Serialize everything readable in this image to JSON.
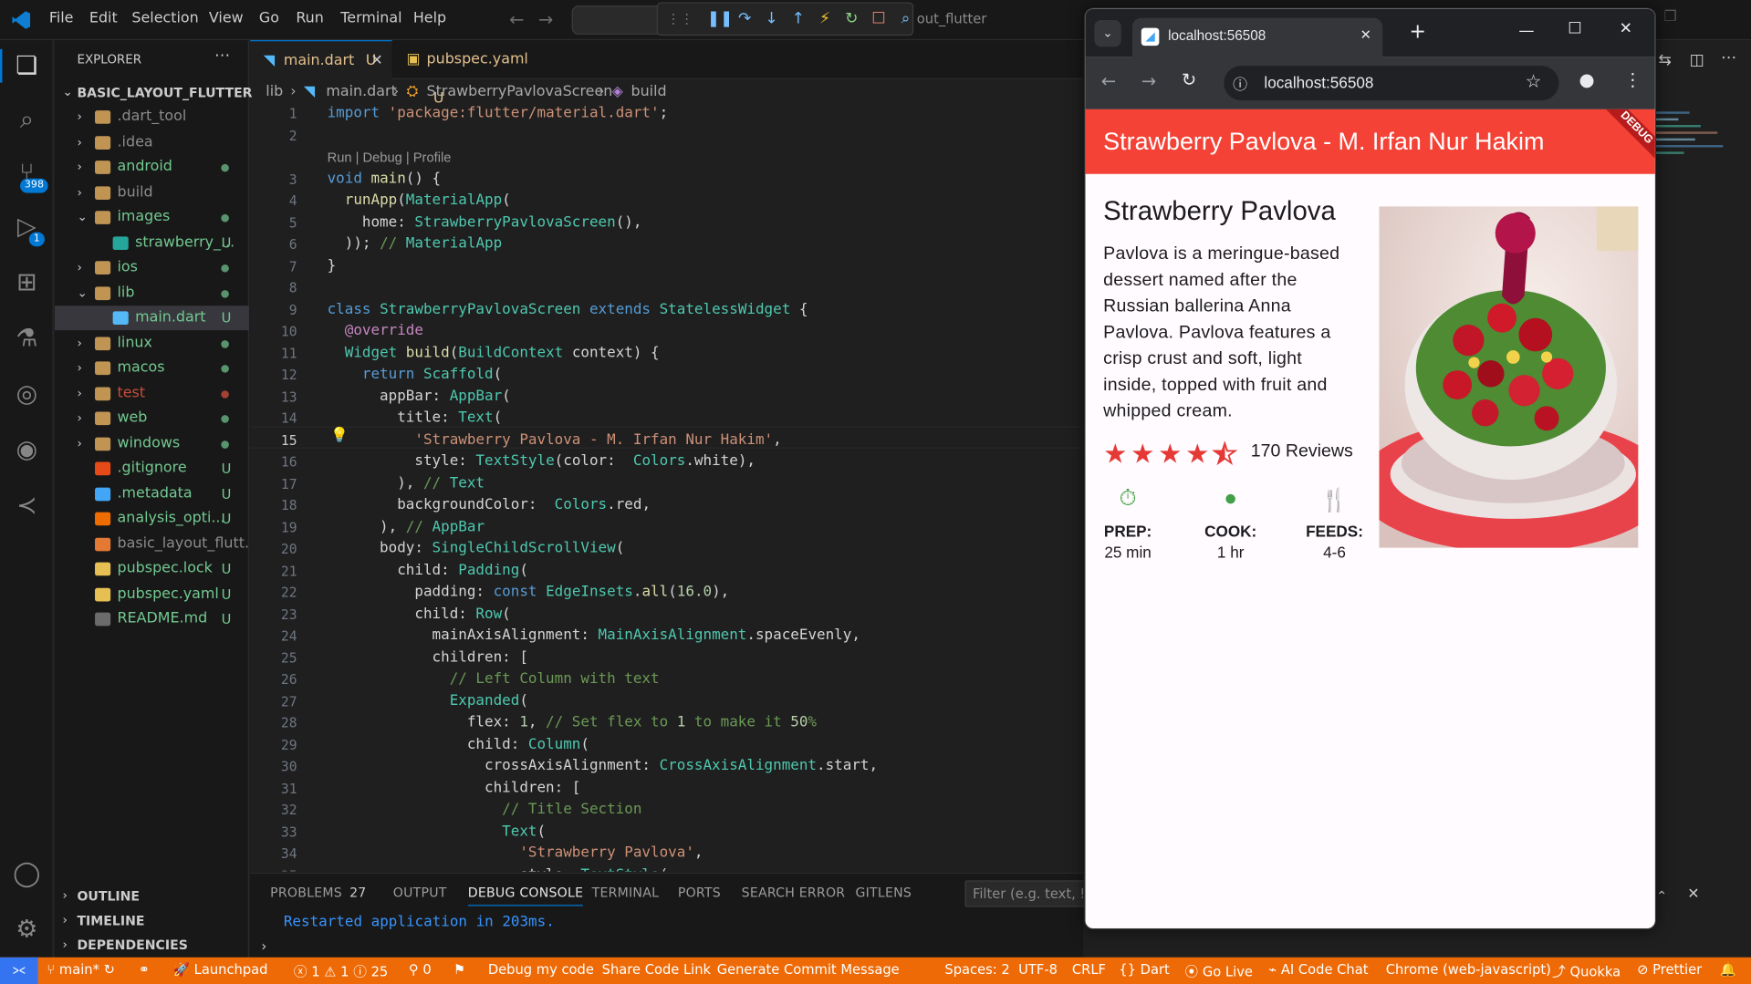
{
  "menu": [
    "File",
    "Edit",
    "Selection",
    "View",
    "Go",
    "Run",
    "Terminal",
    "Help"
  ],
  "search_hint": "out_flutter",
  "activity": {
    "scm_badge": "398",
    "debug_badge": "1"
  },
  "explorer": {
    "header": "EXPLORER",
    "project": "BASIC_LAYOUT_FLUTTER",
    "items": [
      {
        "name": ".dart_tool",
        "type": "folder",
        "status": ""
      },
      {
        "name": ".idea",
        "type": "folder",
        "status": ""
      },
      {
        "name": "android",
        "type": "folder",
        "status": "dot"
      },
      {
        "name": "build",
        "type": "folder",
        "status": ""
      },
      {
        "name": "images",
        "type": "folder-open",
        "status": "dot"
      },
      {
        "name": "strawberry_...",
        "type": "image",
        "status": "U"
      },
      {
        "name": "ios",
        "type": "folder",
        "status": "dot"
      },
      {
        "name": "lib",
        "type": "folder-open",
        "status": "dot"
      },
      {
        "name": "main.dart",
        "type": "dart",
        "status": "U"
      },
      {
        "name": "linux",
        "type": "folder",
        "status": "dot"
      },
      {
        "name": "macos",
        "type": "folder",
        "status": "dot"
      },
      {
        "name": "test",
        "type": "folder",
        "status": "reddot"
      },
      {
        "name": "web",
        "type": "folder",
        "status": "dot"
      },
      {
        "name": "windows",
        "type": "folder",
        "status": "dot"
      },
      {
        "name": ".gitignore",
        "type": "git",
        "status": "U"
      },
      {
        "name": ".metadata",
        "type": "meta",
        "status": "U"
      },
      {
        "name": "analysis_opti...",
        "type": "yaml",
        "status": "U"
      },
      {
        "name": "basic_layout_flutt...",
        "type": "xml",
        "status": ""
      },
      {
        "name": "pubspec.lock",
        "type": "lock",
        "status": "U"
      },
      {
        "name": "pubspec.yaml",
        "type": "yaml2",
        "status": "U"
      },
      {
        "name": "README.md",
        "type": "md",
        "status": "U"
      }
    ],
    "sections": [
      "OUTLINE",
      "TIMELINE",
      "DEPENDENCIES"
    ]
  },
  "tabs": [
    {
      "label": "main.dart",
      "status": "U"
    },
    {
      "label": "pubspec.yaml",
      "status": "U"
    }
  ],
  "breadcrumb": [
    "lib",
    "main.dart",
    "StrawberryPavlovaScreen",
    "build"
  ],
  "codelens": "Run | Debug | Profile",
  "code": [
    {
      "n": "1",
      "t": "import 'package:flutter/material.dart';"
    },
    {
      "n": "2",
      "t": ""
    },
    {
      "n": "3",
      "t": "void main() {"
    },
    {
      "n": "4",
      "t": "  runApp(MaterialApp("
    },
    {
      "n": "5",
      "t": "    home: StrawberryPavlovaScreen(),"
    },
    {
      "n": "6",
      "t": "  )); // MaterialApp"
    },
    {
      "n": "7",
      "t": "}"
    },
    {
      "n": "8",
      "t": ""
    },
    {
      "n": "9",
      "t": "class StrawberryPavlovaScreen extends StatelessWidget {"
    },
    {
      "n": "10",
      "t": "  @override"
    },
    {
      "n": "11",
      "t": "  Widget build(BuildContext context) {"
    },
    {
      "n": "12",
      "t": "    return Scaffold("
    },
    {
      "n": "13",
      "t": "      appBar: AppBar("
    },
    {
      "n": "14",
      "t": "        title: Text("
    },
    {
      "n": "15",
      "t": "          'Strawberry Pavlova - M. Irfan Nur Hakim',"
    },
    {
      "n": "16",
      "t": "          style: TextStyle(color:  Colors.white),"
    },
    {
      "n": "17",
      "t": "        ), // Text"
    },
    {
      "n": "18",
      "t": "        backgroundColor:  Colors.red,"
    },
    {
      "n": "19",
      "t": "      ), // AppBar"
    },
    {
      "n": "20",
      "t": "      body: SingleChildScrollView("
    },
    {
      "n": "21",
      "t": "        child: Padding("
    },
    {
      "n": "22",
      "t": "          padding: const EdgeInsets.all(16.0),"
    },
    {
      "n": "23",
      "t": "          child: Row("
    },
    {
      "n": "24",
      "t": "            mainAxisAlignment: MainAxisAlignment.spaceEvenly,"
    },
    {
      "n": "25",
      "t": "            children: ["
    },
    {
      "n": "26",
      "t": "              // Left Column with text"
    },
    {
      "n": "27",
      "t": "              Expanded("
    },
    {
      "n": "28",
      "t": "                flex: 1, // Set flex to 1 to make it 50%"
    },
    {
      "n": "29",
      "t": "                child: Column("
    },
    {
      "n": "30",
      "t": "                  crossAxisAlignment: CrossAxisAlignment.start,"
    },
    {
      "n": "31",
      "t": "                  children: ["
    },
    {
      "n": "32",
      "t": "                    // Title Section"
    },
    {
      "n": "33",
      "t": "                    Text("
    },
    {
      "n": "34",
      "t": "                      'Strawberry Pavlova',"
    },
    {
      "n": "35",
      "t": "                      style: TextStyle("
    }
  ],
  "panel": {
    "tabs": [
      "PROBLEMS",
      "OUTPUT",
      "DEBUG CONSOLE",
      "TERMINAL",
      "PORTS",
      "SEARCH ERROR",
      "GITLENS"
    ],
    "problems_count": "27",
    "filter_placeholder": "Filter (e.g. text, !ex",
    "console_line": "Restarted application in 203ms."
  },
  "browser": {
    "tab_title": "localhost:56508",
    "url": "localhost:56508",
    "appbar_title": "Strawberry Pavlova - M. Irfan Nur Hakim",
    "debug_banner": "DEBUG",
    "heading": "Strawberry Pavlova",
    "description": "Pavlova is a meringue-based dessert named after the Russian ballerina Anna Pavlova. Pavlova features a crisp crust and soft, light inside, topped with fruit and whipped cream.",
    "rating": 4.5,
    "reviews": "170 Reviews",
    "info": [
      {
        "label": "PREP:",
        "value": "25 min",
        "icon": "timer-icon"
      },
      {
        "label": "COOK:",
        "value": "1 hr",
        "icon": "cookie-icon"
      },
      {
        "label": "FEEDS:",
        "value": "4-6",
        "icon": "restaurant-icon"
      }
    ]
  },
  "statusbar": {
    "branch": "main*",
    "launchpad": "Launchpad",
    "errors": "1",
    "warnings": "1",
    "infos": "25",
    "ports": "0",
    "debug": "Debug my code",
    "share": "Share Code Link",
    "commit": "Generate Commit Message",
    "spaces": "Spaces: 2",
    "encoding": "UTF-8",
    "eol": "CRLF",
    "lang": "Dart",
    "golive": "Go Live",
    "aichat": "AI Code Chat",
    "device": "Chrome (web-javascript)",
    "quokka": "Quokka",
    "prettier": "Prettier"
  },
  "colors": {
    "accent": "#0078d4",
    "statusbar": "#ee6a06",
    "appbar": "#f44336",
    "star": "#e53935",
    "icon_green": "#43a047"
  }
}
